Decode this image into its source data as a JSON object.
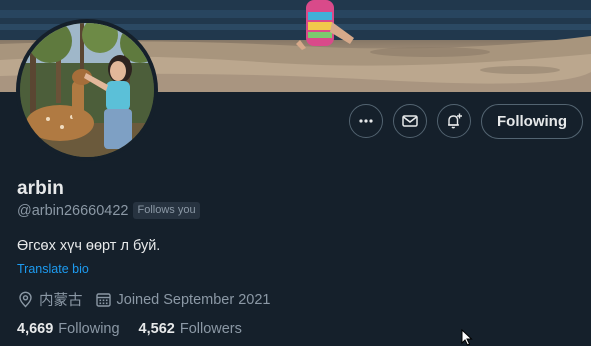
{
  "profile": {
    "display_name": "arbin",
    "handle": "@arbin26660422",
    "follows_you_badge": "Follows you",
    "bio": "Өгсөх хүч өөрт л буй.",
    "translate_link": "Translate bio",
    "location": "内蒙古",
    "joined": "Joined September 2021"
  },
  "actions": {
    "following_label": "Following"
  },
  "stats": {
    "following_count": "4,669",
    "following_label": "Following",
    "followers_count": "4,562",
    "followers_label": "Followers"
  },
  "colors": {
    "background": "#15202b",
    "text_primary": "#e7e9ea",
    "text_secondary": "#8b98a5",
    "link": "#1d9bf0",
    "border": "#536471"
  }
}
